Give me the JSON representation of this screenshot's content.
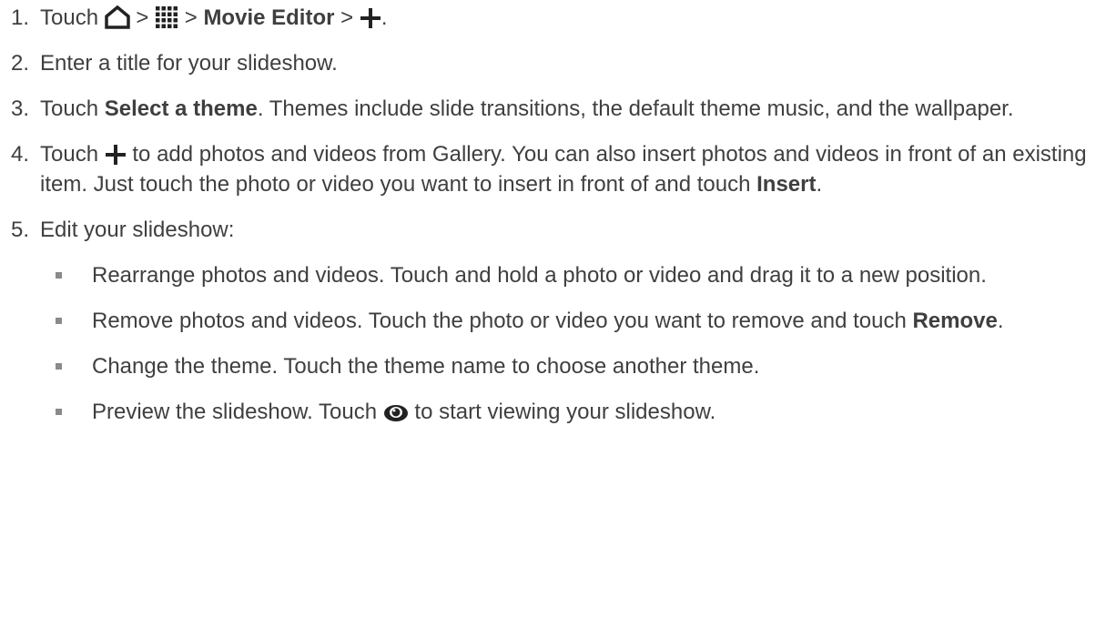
{
  "steps": [
    {
      "num": "1.",
      "pre": "Touch",
      "sep1": ">",
      "sep2": ">",
      "bold": "Movie Editor",
      "sep3": ">",
      "end": ".",
      "icons": [
        "home-icon",
        "apps-grid-icon",
        "plus-icon"
      ]
    },
    {
      "num": "2.",
      "text": "Enter a title for your slideshow."
    },
    {
      "num": "3.",
      "pre": "Touch ",
      "bold": "Select a theme",
      "post": ". Themes include slide transitions, the default theme music, and the wallpaper."
    },
    {
      "num": "4.",
      "pre": "Touch",
      "post": "to add photos and videos from Gallery. You can also insert photos and videos in front of an existing item. Just touch the photo or video you want to insert in front of and touch ",
      "bold": "Insert",
      "end": ".",
      "icons": [
        "plus-icon"
      ]
    },
    {
      "num": "5.",
      "text": "Edit your slideshow:",
      "bullets": [
        {
          "text": "Rearrange photos and videos. Touch and hold a photo or video and drag it to a new position."
        },
        {
          "pre": "Remove photos and videos. Touch the photo or video you want to remove and touch ",
          "bold": "Remove",
          "end": "."
        },
        {
          "text": "Change the theme. Touch the theme name to choose another theme."
        },
        {
          "pre": "Preview the slideshow. Touch",
          "post": "to start viewing your slideshow.",
          "icons": [
            "eye-icon"
          ]
        }
      ]
    }
  ],
  "colors": {
    "text": "#3f3f3f",
    "bullet": "#8a8a8a",
    "icon": "#222222"
  }
}
